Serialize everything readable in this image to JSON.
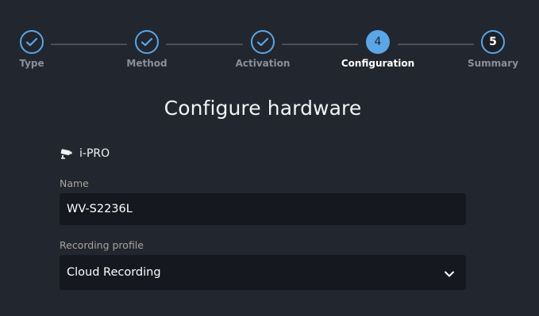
{
  "stepper": {
    "steps": [
      {
        "label": "Type",
        "number": "1",
        "state": "done"
      },
      {
        "label": "Method",
        "number": "2",
        "state": "done"
      },
      {
        "label": "Activation",
        "number": "3",
        "state": "done"
      },
      {
        "label": "Configuration",
        "number": "4",
        "state": "active"
      },
      {
        "label": "Summary",
        "number": "5",
        "state": "pending"
      }
    ]
  },
  "main": {
    "title": "Configure hardware",
    "vendor": {
      "name": "i-PRO",
      "icon": "security-camera-icon"
    },
    "name_field": {
      "label": "Name",
      "value": "WV-S2236L"
    },
    "recording_profile": {
      "label": "Recording profile",
      "selected": "Cloud Recording",
      "icon": "chevron-down-icon"
    }
  },
  "colors": {
    "background": "#22262f",
    "accent": "#5ba6e6",
    "input_background": "#15181e",
    "connector": "#4b505b",
    "muted_label": "#8a8f99"
  }
}
